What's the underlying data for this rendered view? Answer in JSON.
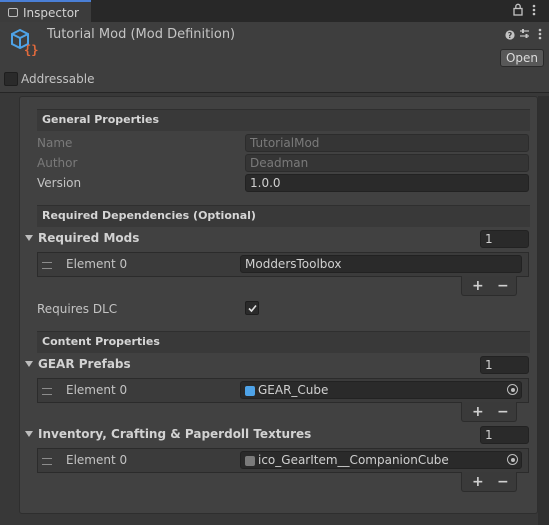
{
  "tab": {
    "title": "Inspector"
  },
  "header": {
    "title": "Tutorial Mod (Mod Definition)",
    "open_label": "Open",
    "addressable_label": "Addressable"
  },
  "general": {
    "heading": "General Properties",
    "name_label": "Name",
    "name_value": "TutorialMod",
    "author_label": "Author",
    "author_value": "Deadman",
    "version_label": "Version",
    "version_value": "1.0.0"
  },
  "deps": {
    "heading": "Required Dependencies (Optional)",
    "required_mods_label": "Required Mods",
    "required_mods_count": "1",
    "element_label": "Element 0",
    "element_value": "ModdersToolbox",
    "requires_dlc_label": "Requires DLC",
    "requires_dlc_checked": true
  },
  "content": {
    "heading": "Content Properties",
    "gear_label": "GEAR Prefabs",
    "gear_count": "1",
    "gear_element_label": "Element 0",
    "gear_element_value": "GEAR_Cube",
    "tex_label": "Inventory, Crafting & Paperdoll Textures",
    "tex_count": "1",
    "tex_element_label": "Element 0",
    "tex_element_value": "ico_GearItem__CompanionCube"
  },
  "list_buttons": {
    "plus": "+",
    "minus": "−"
  },
  "icons": [
    "inspector-icon",
    "lock-icon",
    "menu-icon",
    "mod-definition-icon",
    "help-icon",
    "settings-icon",
    "drag-handle-icon",
    "prefab-icon",
    "texture-icon",
    "object-picker-icon",
    "foldout-arrow-icon"
  ]
}
